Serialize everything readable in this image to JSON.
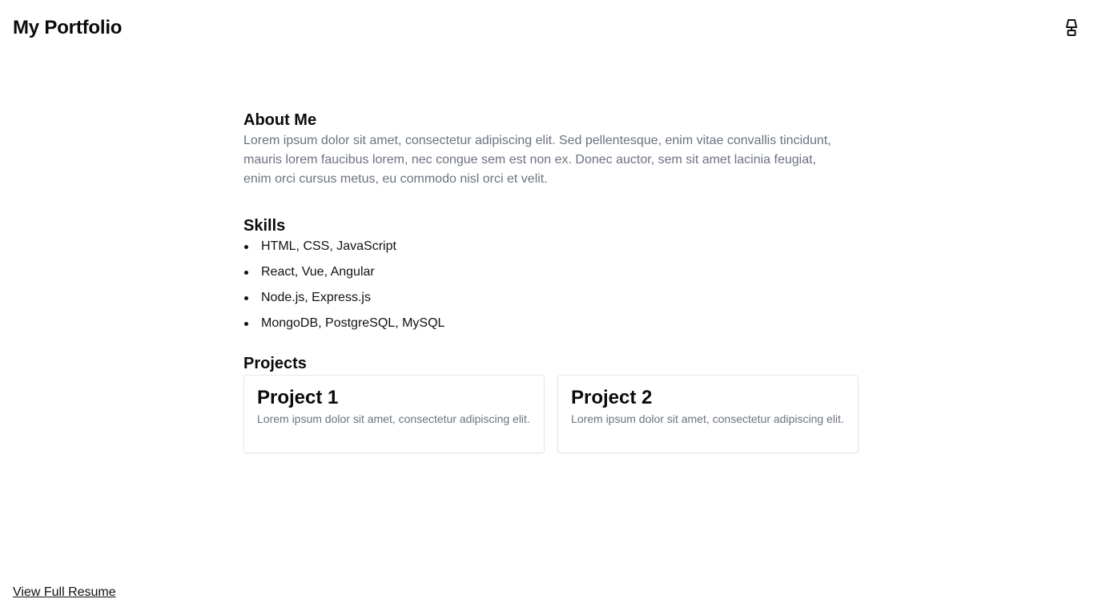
{
  "header": {
    "title": "My Portfolio",
    "toggle_icon": "lamp-icon"
  },
  "about": {
    "heading": "About Me",
    "text": "Lorem ipsum dolor sit amet, consectetur adipiscing elit. Sed pellentesque, enim vitae convallis tincidunt, mauris lorem faucibus lorem, nec congue sem est non ex. Donec auctor, sem sit amet lacinia feugiat, enim orci cursus metus, eu commodo nisl orci et velit."
  },
  "skills": {
    "heading": "Skills",
    "items": [
      "HTML, CSS, JavaScript",
      "React, Vue, Angular",
      "Node.js, Express.js",
      "MongoDB, PostgreSQL, MySQL"
    ]
  },
  "projects": {
    "heading": "Projects",
    "items": [
      {
        "title": "Project 1",
        "description": "Lorem ipsum dolor sit amet, consectetur adipiscing elit."
      },
      {
        "title": "Project 2",
        "description": "Lorem ipsum dolor sit amet, consectetur adipiscing elit."
      }
    ]
  },
  "footer": {
    "resume_link": "View Full Resume"
  },
  "colors": {
    "text": "#111111",
    "muted": "#6b7280",
    "border": "#e5e7eb",
    "background": "#ffffff"
  }
}
